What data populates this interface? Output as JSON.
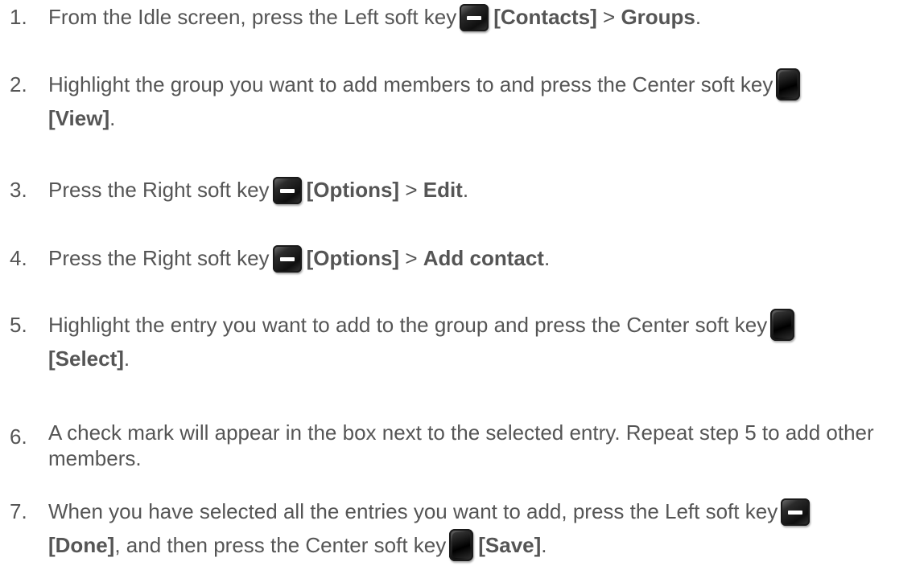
{
  "steps": [
    {
      "num": "1.",
      "t1": "From the Idle screen, press the Left soft key",
      "k1": "[Contacts]",
      "t2": " > ",
      "k2": "Groups",
      "t3": "."
    },
    {
      "num": "2.",
      "t1": "Highlight the group you want to add members to and press the Center soft key",
      "k1": "[View]",
      "t2": "."
    },
    {
      "num": "3.",
      "t1": "Press the Right soft key",
      "k1": "[Options]",
      "t2": " > ",
      "k2": "Edit",
      "t3": "."
    },
    {
      "num": "4.",
      "t1": "Press the Right soft key",
      "k1": "[Options]",
      "t2": " > ",
      "k2": "Add contact",
      "t3": "."
    },
    {
      "num": "5.",
      "t1": "Highlight the entry you want to add to the group and press the Center soft key",
      "k1": "[Select]",
      "t2": "."
    },
    {
      "num": "6.",
      "t1": "A check mark will appear in the box next to the selected entry. Repeat step 5 to add other members."
    },
    {
      "num": "7.",
      "t1": "When you have selected all the entries you want to add, press the Left soft key",
      "k1": "[Done]",
      "t2": ", and then press the Center soft key",
      "k2": "[Save]",
      "t3": "."
    }
  ],
  "icons": {
    "left_soft_key": "left-soft-key-icon",
    "right_soft_key": "right-soft-key-icon",
    "center_soft_key": "center-soft-key-icon"
  }
}
